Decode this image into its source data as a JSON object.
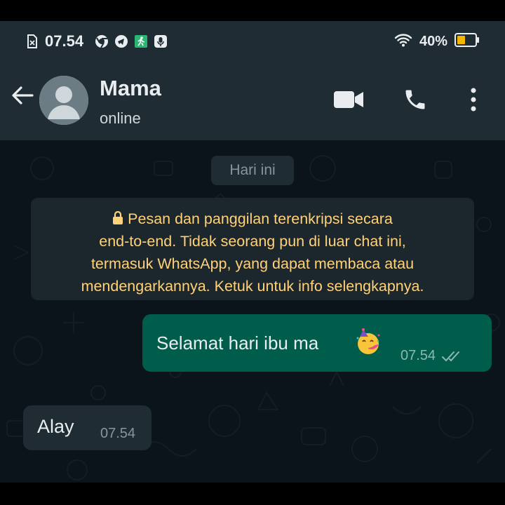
{
  "status_bar": {
    "time": "07.54",
    "battery": "40%",
    "icons": [
      "sim-icon",
      "chrome-icon",
      "telegram-icon",
      "fitness-app-icon",
      "voice-icon",
      "wifi-icon",
      "battery-icon"
    ]
  },
  "header": {
    "contact_name": "Mama",
    "status": "online",
    "icons": [
      "back-arrow-icon",
      "avatar-placeholder-icon",
      "video-call-icon",
      "phone-icon",
      "more-options-icon"
    ]
  },
  "chat": {
    "date_chip": "Hari ini",
    "encryption_notice": {
      "lines": [
        "Pesan dan panggilan terenkripsi secara",
        "end-to-end. Tidak seorang pun di luar chat ini,",
        "termasuk WhatsApp, yang dapat membaca atau",
        "mendengarkannya. Ketuk untuk info selengkapnya."
      ],
      "icon": "lock-icon"
    },
    "messages": [
      {
        "direction": "outgoing",
        "text": "Selamat hari ibu ma",
        "emoji": "party-face-emoji",
        "time": "07.54",
        "status_icon": "double-check-icon"
      },
      {
        "direction": "incoming",
        "text": "Alay",
        "time": "07.54"
      }
    ]
  },
  "colors": {
    "header_bg": "#1f2c34",
    "chat_bg": "#0b141a",
    "outgoing_bubble": "#005c4b",
    "incoming_bubble": "#202c33",
    "notice_text": "#ffd279"
  }
}
